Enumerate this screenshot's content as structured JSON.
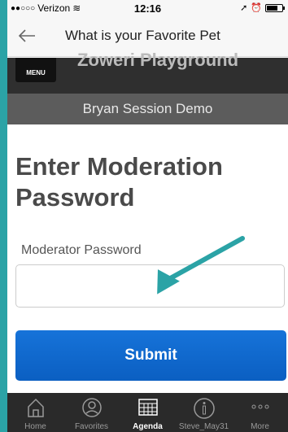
{
  "status_bar": {
    "carrier": "Verizon",
    "time": "12:16"
  },
  "nav": {
    "title": "What is your Favorite Pet"
  },
  "header": {
    "menu_label": "MENU",
    "app_title_cut": "Zoweri Playground"
  },
  "session": {
    "title": "Bryan Session Demo"
  },
  "main": {
    "heading": "Enter Moderation Password",
    "field_label": "Moderator Password",
    "password_value": "",
    "submit_label": "Submit"
  },
  "tabs": [
    {
      "label": "Home",
      "icon": "home-icon"
    },
    {
      "label": "Favorites",
      "icon": "person-icon"
    },
    {
      "label": "Agenda",
      "icon": "calendar-icon",
      "active": true
    },
    {
      "label": "Steve_May31",
      "icon": "info-icon"
    },
    {
      "label": "More",
      "icon": "more-icon"
    }
  ],
  "colors": {
    "accent_arrow": "#2ba3a6",
    "button": "#0f67cc",
    "background": "#2ba3a6"
  }
}
